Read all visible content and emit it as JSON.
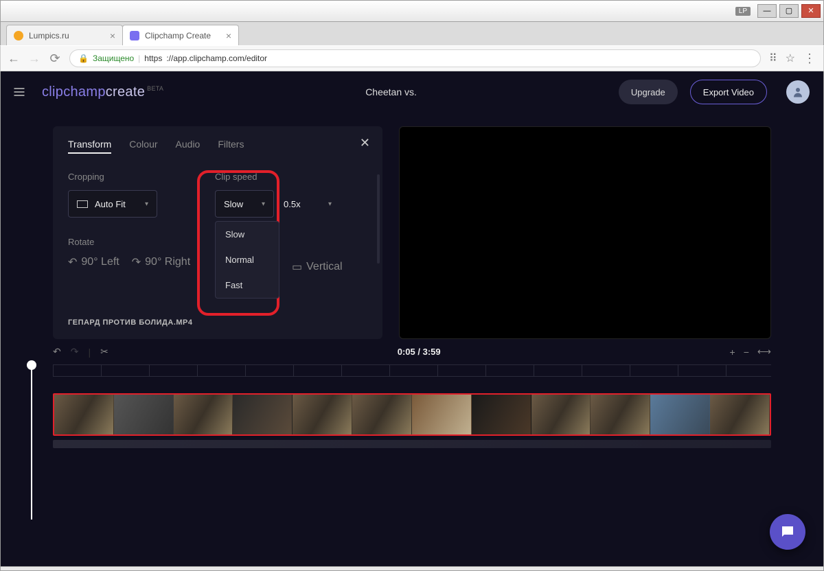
{
  "window": {
    "user_badge": "LP"
  },
  "tabs": [
    {
      "title": "Lumpics.ru",
      "favicon_color": "#f5a623",
      "active": false
    },
    {
      "title": "Clipchamp Create",
      "favicon_color": "#7a6ff0",
      "active": true
    }
  ],
  "urlbar": {
    "secure_label": "Защищено",
    "protocol": "https",
    "host_path": "://app.clipchamp.com/editor"
  },
  "header": {
    "logo_a": "clipchamp",
    "logo_b": "create",
    "beta": "BETA",
    "project_title": "Cheetan vs.",
    "upgrade": "Upgrade",
    "export": "Export Video"
  },
  "panel": {
    "tabs": {
      "transform": "Transform",
      "colour": "Colour",
      "audio": "Audio",
      "filters": "Filters"
    },
    "cropping_label": "Cropping",
    "autofit": "Auto Fit",
    "clipspeed_label": "Clip speed",
    "speed_selected": "Slow",
    "speed_options": {
      "slow": "Slow",
      "normal": "Normal",
      "fast": "Fast"
    },
    "multiplier": "0.5x",
    "rotate_label": "Rotate",
    "rot_left": "90° Left",
    "rot_right": "90° Right",
    "flip_vertical": "Vertical",
    "filename": "ГЕПАРД ПРОТИВ БОЛИДА.MP4"
  },
  "timeline": {
    "time": "0:05 / 3:59"
  }
}
